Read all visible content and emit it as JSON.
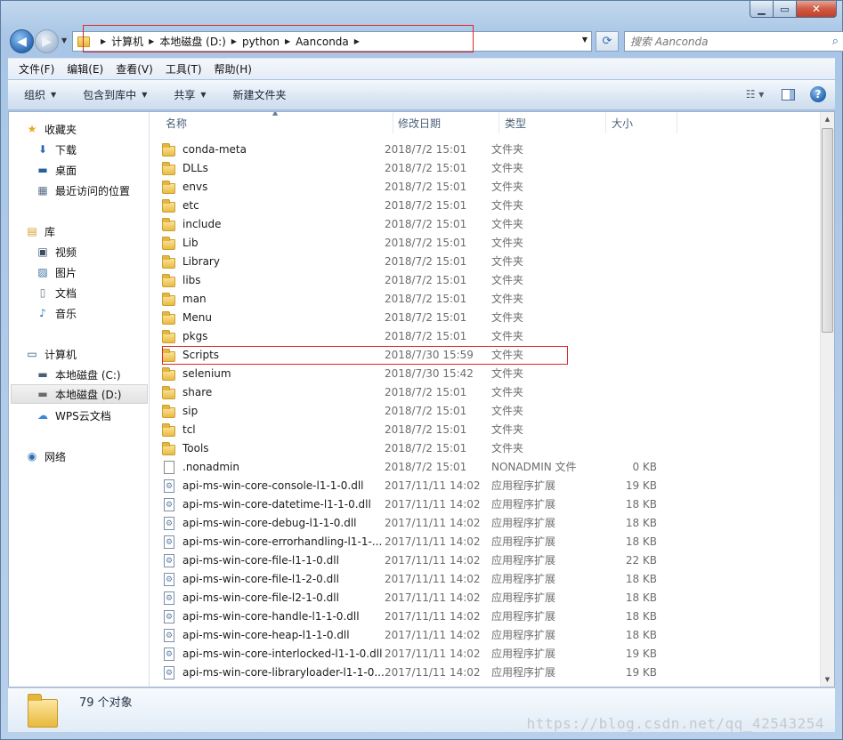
{
  "caption": {
    "minimize": "▁",
    "maximize": "▭",
    "close": "✕"
  },
  "nav": {
    "back": "◀",
    "forward": "▶"
  },
  "address": {
    "crumbs": [
      "计算机",
      "本地磁盘 (D:)",
      "python",
      "Aanconda"
    ]
  },
  "search": {
    "placeholder": "搜索 Aanconda"
  },
  "menubar": [
    "文件(F)",
    "编辑(E)",
    "查看(V)",
    "工具(T)",
    "帮助(H)"
  ],
  "toolbar": {
    "organize": "组织",
    "include_in_library": "包含到库中",
    "share": "共享",
    "new_folder": "新建文件夹"
  },
  "sidebar": {
    "favorites": {
      "label": "收藏夹",
      "items": [
        "下载",
        "桌面",
        "最近访问的位置"
      ]
    },
    "libraries": {
      "label": "库",
      "items": [
        "视频",
        "图片",
        "文档",
        "音乐"
      ]
    },
    "computer": {
      "label": "计算机",
      "items": [
        "本地磁盘 (C:)",
        "本地磁盘 (D:)",
        "WPS云文档"
      ]
    },
    "network": {
      "label": "网络"
    }
  },
  "columns": {
    "name": "名称",
    "date": "修改日期",
    "type": "类型",
    "size": "大小"
  },
  "files": [
    {
      "name": "conda-meta",
      "date": "2018/7/2 15:01",
      "type": "文件夹",
      "size": "",
      "kind": "folder"
    },
    {
      "name": "DLLs",
      "date": "2018/7/2 15:01",
      "type": "文件夹",
      "size": "",
      "kind": "folder"
    },
    {
      "name": "envs",
      "date": "2018/7/2 15:01",
      "type": "文件夹",
      "size": "",
      "kind": "folder"
    },
    {
      "name": "etc",
      "date": "2018/7/2 15:01",
      "type": "文件夹",
      "size": "",
      "kind": "folder"
    },
    {
      "name": "include",
      "date": "2018/7/2 15:01",
      "type": "文件夹",
      "size": "",
      "kind": "folder"
    },
    {
      "name": "Lib",
      "date": "2018/7/2 15:01",
      "type": "文件夹",
      "size": "",
      "kind": "folder"
    },
    {
      "name": "Library",
      "date": "2018/7/2 15:01",
      "type": "文件夹",
      "size": "",
      "kind": "folder"
    },
    {
      "name": "libs",
      "date": "2018/7/2 15:01",
      "type": "文件夹",
      "size": "",
      "kind": "folder"
    },
    {
      "name": "man",
      "date": "2018/7/2 15:01",
      "type": "文件夹",
      "size": "",
      "kind": "folder"
    },
    {
      "name": "Menu",
      "date": "2018/7/2 15:01",
      "type": "文件夹",
      "size": "",
      "kind": "folder"
    },
    {
      "name": "pkgs",
      "date": "2018/7/2 15:01",
      "type": "文件夹",
      "size": "",
      "kind": "folder"
    },
    {
      "name": "Scripts",
      "date": "2018/7/30 15:59",
      "type": "文件夹",
      "size": "",
      "kind": "folder"
    },
    {
      "name": "selenium",
      "date": "2018/7/30 15:42",
      "type": "文件夹",
      "size": "",
      "kind": "folder"
    },
    {
      "name": "share",
      "date": "2018/7/2 15:01",
      "type": "文件夹",
      "size": "",
      "kind": "folder"
    },
    {
      "name": "sip",
      "date": "2018/7/2 15:01",
      "type": "文件夹",
      "size": "",
      "kind": "folder"
    },
    {
      "name": "tcl",
      "date": "2018/7/2 15:01",
      "type": "文件夹",
      "size": "",
      "kind": "folder"
    },
    {
      "name": "Tools",
      "date": "2018/7/2 15:01",
      "type": "文件夹",
      "size": "",
      "kind": "folder"
    },
    {
      "name": ".nonadmin",
      "date": "2018/7/2 15:01",
      "type": "NONADMIN 文件",
      "size": "0 KB",
      "kind": "file"
    },
    {
      "name": "api-ms-win-core-console-l1-1-0.dll",
      "date": "2017/11/11 14:02",
      "type": "应用程序扩展",
      "size": "19 KB",
      "kind": "dll"
    },
    {
      "name": "api-ms-win-core-datetime-l1-1-0.dll",
      "date": "2017/11/11 14:02",
      "type": "应用程序扩展",
      "size": "18 KB",
      "kind": "dll"
    },
    {
      "name": "api-ms-win-core-debug-l1-1-0.dll",
      "date": "2017/11/11 14:02",
      "type": "应用程序扩展",
      "size": "18 KB",
      "kind": "dll"
    },
    {
      "name": "api-ms-win-core-errorhandling-l1-1-...",
      "date": "2017/11/11 14:02",
      "type": "应用程序扩展",
      "size": "18 KB",
      "kind": "dll"
    },
    {
      "name": "api-ms-win-core-file-l1-1-0.dll",
      "date": "2017/11/11 14:02",
      "type": "应用程序扩展",
      "size": "22 KB",
      "kind": "dll"
    },
    {
      "name": "api-ms-win-core-file-l1-2-0.dll",
      "date": "2017/11/11 14:02",
      "type": "应用程序扩展",
      "size": "18 KB",
      "kind": "dll"
    },
    {
      "name": "api-ms-win-core-file-l2-1-0.dll",
      "date": "2017/11/11 14:02",
      "type": "应用程序扩展",
      "size": "18 KB",
      "kind": "dll"
    },
    {
      "name": "api-ms-win-core-handle-l1-1-0.dll",
      "date": "2017/11/11 14:02",
      "type": "应用程序扩展",
      "size": "18 KB",
      "kind": "dll"
    },
    {
      "name": "api-ms-win-core-heap-l1-1-0.dll",
      "date": "2017/11/11 14:02",
      "type": "应用程序扩展",
      "size": "18 KB",
      "kind": "dll"
    },
    {
      "name": "api-ms-win-core-interlocked-l1-1-0.dll",
      "date": "2017/11/11 14:02",
      "type": "应用程序扩展",
      "size": "19 KB",
      "kind": "dll"
    },
    {
      "name": "api-ms-win-core-libraryloader-l1-1-0....",
      "date": "2017/11/11 14:02",
      "type": "应用程序扩展",
      "size": "19 KB",
      "kind": "dll"
    }
  ],
  "status": {
    "count": "79 个对象"
  },
  "watermark": "https://blog.csdn.net/qq_42543254"
}
